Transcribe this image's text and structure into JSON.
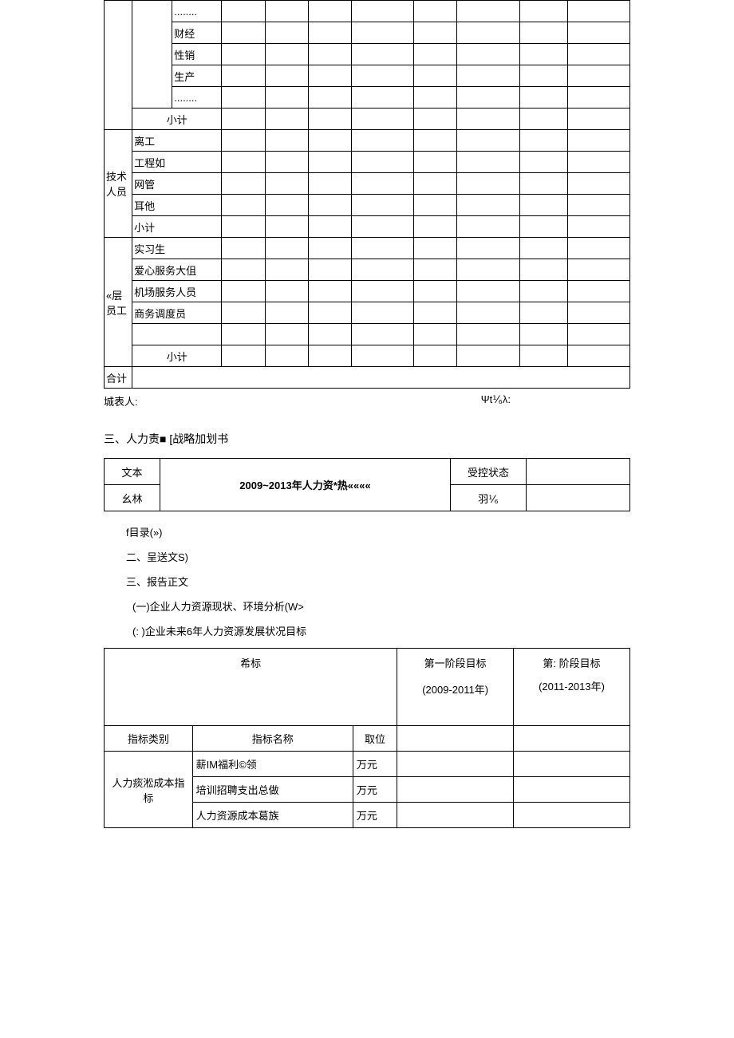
{
  "table1": {
    "group_a_items": [
      "........",
      "财经",
      "性销",
      "生产",
      "........"
    ],
    "group_a_subtotal": "小计",
    "group_b_label": "技术人员",
    "group_b_items": [
      "离工",
      "工程如",
      "网管",
      "耳他",
      "小计"
    ],
    "group_c_label": "«层员工",
    "group_c_items": [
      "实习生",
      "爱心服务大伹",
      "机场服务人员",
      "商务调度员",
      ""
    ],
    "group_c_subtotal": "小计",
    "total_label": "合计"
  },
  "signatures": {
    "left": "城表人:",
    "right": "Ψt⅟₆λ:"
  },
  "section3_title": "三、人力责■ [战略加划书",
  "table2": {
    "doc_label": "文本",
    "author_label": "幺林",
    "title": "2009~2013年人力资*热«««« ",
    "control_label": "受控状态",
    "code_label": "羽⅟₆"
  },
  "toc": {
    "l1": "f目录(»)",
    "l2": "二、呈送文S)",
    "l3": "三、报告正文",
    "l4": "(一)企业人力资源现状、环境分析(W>",
    "l5": "(: )企业未来6年人力资源发展状况目标"
  },
  "table3": {
    "hdr_target": "希标",
    "hdr_phase1": "第一阶段目标",
    "hdr_phase1_years": "(2009-2011年)",
    "hdr_phase2": "第: 阶段目标",
    "hdr_phase2_years": "(2011-2013年)",
    "col_category": "指标类别",
    "col_name": "指标名称",
    "col_unit": "取位",
    "cat1": "人力痰淞成本指标",
    "rows": [
      {
        "name": "薪IM福利©领",
        "unit": "万元"
      },
      {
        "name": "培训招聘支出总做",
        "unit": "万元"
      },
      {
        "name": "人力资源成本葛族",
        "unit": "万元"
      }
    ]
  }
}
